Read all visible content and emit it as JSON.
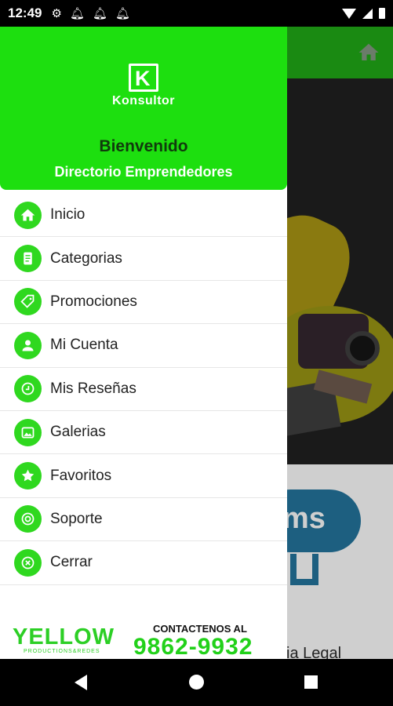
{
  "status_bar": {
    "time": "12:49",
    "icons": [
      "gear-icon",
      "bell-icon",
      "bell-icon",
      "bell-icon"
    ]
  },
  "drawer": {
    "logo_letter": "K",
    "logo_text": "Konsultor",
    "welcome": "Bienvenido",
    "subtitle": "Directorio Emprendedores",
    "items": [
      {
        "label": "Inicio",
        "icon": "home-icon"
      },
      {
        "label": "Categorias",
        "icon": "document-icon"
      },
      {
        "label": "Promociones",
        "icon": "tag-icon"
      },
      {
        "label": "Mi Cuenta",
        "icon": "person-icon"
      },
      {
        "label": "Mis Reseñas",
        "icon": "review-icon"
      },
      {
        "label": "Galerias",
        "icon": "gallery-icon"
      },
      {
        "label": "Favoritos",
        "icon": "star-icon"
      },
      {
        "label": "Soporte",
        "icon": "support-icon"
      },
      {
        "label": "Cerrar",
        "icon": "close-icon"
      }
    ],
    "footer": {
      "brand": "YELLOW",
      "brand_sub": "PRODUCTIONS&REDES",
      "contact_label": "CONTACTENOS AL",
      "phone": "9862-9932"
    }
  },
  "background": {
    "promo_text": "ms",
    "caption": "ia Legal"
  },
  "colors": {
    "accent": "#1ddf0f",
    "icon_bg": "#2fd81f",
    "toolbar_dimmed": "#1a8a12"
  }
}
